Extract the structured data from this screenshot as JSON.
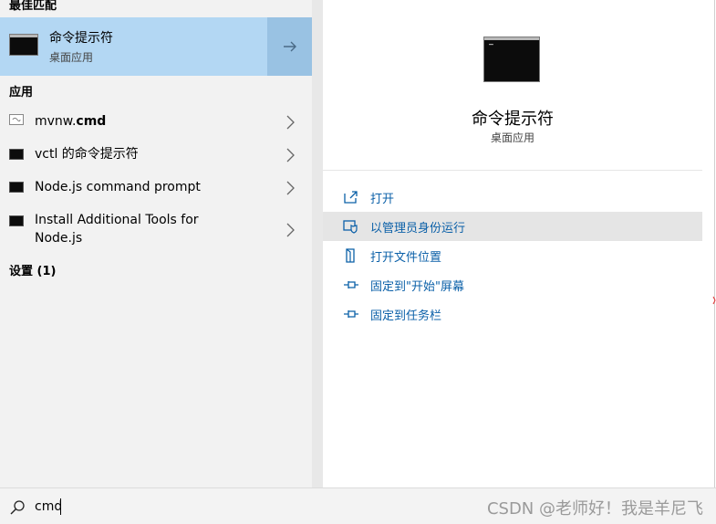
{
  "left": {
    "best_match_heading": "最佳匹配",
    "best_match": {
      "title": "命令提示符",
      "subtitle": "桌面应用",
      "icon": "cmd-icon",
      "arrow_icon": "arrow-right-icon"
    },
    "apps_heading": "应用",
    "apps": [
      {
        "label_plain": "mvnw.",
        "label_bold": "cmd",
        "icon": "script-file-icon"
      },
      {
        "label": "vctl 的命令提示符",
        "icon": "cmd-icon"
      },
      {
        "label": "Node.js command prompt",
        "icon": "cmd-icon"
      },
      {
        "label_line1": "Install Additional Tools for",
        "label_line2": "Node.js",
        "icon": "cmd-icon"
      }
    ],
    "settings_heading": "设置 (1)"
  },
  "detail": {
    "title": "命令提示符",
    "subtitle": "桌面应用",
    "icon": "cmd-icon",
    "actions": [
      {
        "label": "打开",
        "icon": "open-icon"
      },
      {
        "label": "以管理员身份运行",
        "icon": "run-as-admin-icon",
        "highlighted": true
      },
      {
        "label": "打开文件位置",
        "icon": "file-location-icon"
      },
      {
        "label": "固定到\"开始\"屏幕",
        "icon": "pin-icon"
      },
      {
        "label": "固定到任务栏",
        "icon": "pin-icon"
      }
    ]
  },
  "search": {
    "value": "cmd",
    "icon": "search-icon"
  },
  "watermark": "CSDN @老师好！我是羊尼飞",
  "colors": {
    "accent_blue": "#0b60a8",
    "selection": "#b3d7f3",
    "selection_arrow": "#99c2e3",
    "hover": "#e5e5e5"
  }
}
